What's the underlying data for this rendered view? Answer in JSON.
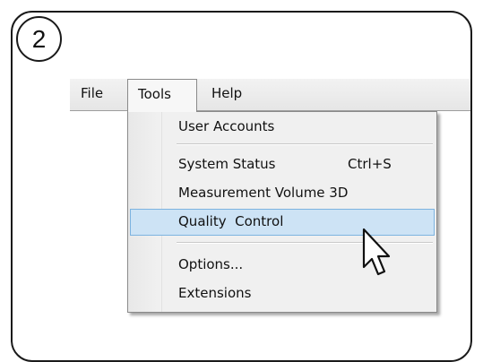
{
  "step": {
    "number": "2"
  },
  "menubar": {
    "items": [
      {
        "label": "File"
      },
      {
        "label": "Tools"
      },
      {
        "label": "Help"
      }
    ],
    "active": "Tools"
  },
  "dropdown": {
    "items": [
      {
        "label": "User Accounts",
        "shortcut": ""
      },
      {
        "label": "System Status",
        "shortcut": "Ctrl+S"
      },
      {
        "label": "Measurement Volume 3D",
        "shortcut": ""
      },
      {
        "label": "Quality  Control",
        "shortcut": "",
        "highlighted": true
      },
      {
        "label": "Options...",
        "shortcut": ""
      },
      {
        "label": "Extensions",
        "shortcut": ""
      }
    ]
  },
  "colors": {
    "highlight_fill": "#cde3f5",
    "highlight_border": "#7cb3e0",
    "menu_bg": "#f0f0f0"
  },
  "icons": {
    "cursor": "arrow-pointer-icon"
  }
}
